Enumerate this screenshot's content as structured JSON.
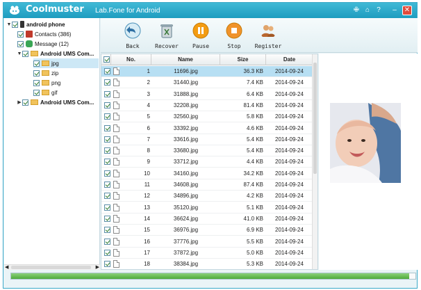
{
  "app": {
    "name": "Coolmuster",
    "subtitle": "Lab.Fone for Android",
    "controls": [
      "pin",
      "home",
      "help",
      "minimize",
      "close"
    ]
  },
  "tree": [
    {
      "label": "android phone",
      "bold": true,
      "icon": "phone-icon",
      "expanded": true
    },
    {
      "label": "Contacts (386)",
      "icon": "contacts-icon"
    },
    {
      "label": "Message (12)",
      "icon": "message-icon"
    },
    {
      "label": "Android   UMS Com...",
      "bold": true,
      "icon": "folder-icon",
      "expanded": true
    },
    {
      "label": "jpg",
      "icon": "folder-icon",
      "selected": true
    },
    {
      "label": "zip",
      "icon": "folder-icon"
    },
    {
      "label": "png",
      "icon": "folder-icon"
    },
    {
      "label": "gif",
      "icon": "folder-icon"
    },
    {
      "label": "Android   UMS Com...",
      "bold": true,
      "icon": "folder-icon",
      "expanded": false
    }
  ],
  "toolbar": {
    "back": "Back",
    "recover": "Recover",
    "pause": "Pause",
    "stop": "Stop",
    "register": "Register"
  },
  "table": {
    "headers": {
      "no": "No.",
      "name": "Name",
      "size": "Size",
      "date": "Date"
    },
    "rows": [
      {
        "no": "1",
        "name": "11696.jpg",
        "size": "36.3 KB",
        "date": "2014-09-24"
      },
      {
        "no": "2",
        "name": "31440.jpg",
        "size": "7.4 KB",
        "date": "2014-09-24"
      },
      {
        "no": "3",
        "name": "31888.jpg",
        "size": "6.4 KB",
        "date": "2014-09-24"
      },
      {
        "no": "4",
        "name": "32208.jpg",
        "size": "81.4 KB",
        "date": "2014-09-24"
      },
      {
        "no": "5",
        "name": "32560.jpg",
        "size": "5.8 KB",
        "date": "2014-09-24"
      },
      {
        "no": "6",
        "name": "33392.jpg",
        "size": "4.6 KB",
        "date": "2014-09-24"
      },
      {
        "no": "7",
        "name": "33616.jpg",
        "size": "5.4 KB",
        "date": "2014-09-24"
      },
      {
        "no": "8",
        "name": "33680.jpg",
        "size": "5.4 KB",
        "date": "2014-09-24"
      },
      {
        "no": "9",
        "name": "33712.jpg",
        "size": "4.4 KB",
        "date": "2014-09-24"
      },
      {
        "no": "10",
        "name": "34160.jpg",
        "size": "34.2 KB",
        "date": "2014-09-24"
      },
      {
        "no": "11",
        "name": "34608.jpg",
        "size": "87.4 KB",
        "date": "2014-09-24"
      },
      {
        "no": "12",
        "name": "34896.jpg",
        "size": "4.2 KB",
        "date": "2014-09-24"
      },
      {
        "no": "13",
        "name": "35120.jpg",
        "size": "5.1 KB",
        "date": "2014-09-24"
      },
      {
        "no": "14",
        "name": "36624.jpg",
        "size": "41.0 KB",
        "date": "2014-09-24"
      },
      {
        "no": "15",
        "name": "36976.jpg",
        "size": "6.9 KB",
        "date": "2014-09-24"
      },
      {
        "no": "16",
        "name": "37776.jpg",
        "size": "5.5 KB",
        "date": "2014-09-24"
      },
      {
        "no": "17",
        "name": "37872.jpg",
        "size": "5.0 KB",
        "date": "2014-09-24"
      },
      {
        "no": "18",
        "name": "38384.jpg",
        "size": "5.3 KB",
        "date": "2014-09-24"
      }
    ]
  },
  "progress": {
    "fraction": 0.985
  },
  "colors": {
    "accent": "#1e9cbf",
    "selection": "#b7dff3",
    "progress": "#4eab3b"
  }
}
